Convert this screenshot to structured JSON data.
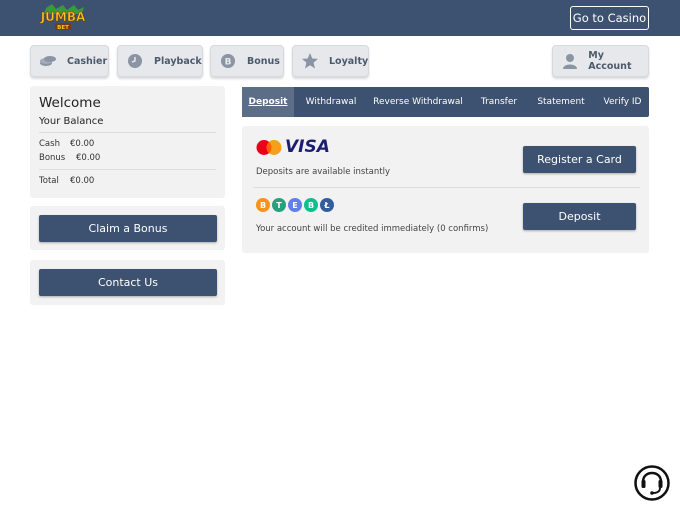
{
  "header": {
    "logo_text": "JUMBA",
    "logo_subtext": "BET",
    "go_casino_label": "Go to Casino"
  },
  "nav": {
    "cashier": "Cashier",
    "playback": "Playback",
    "bonus": "Bonus",
    "loyalty": "Loyalty",
    "my_account": "My Account"
  },
  "sidebar": {
    "welcome": "Welcome",
    "your_balance": "Your Balance",
    "cash_label": "Cash",
    "cash_value": "€0.00",
    "bonus_label": "Bonus",
    "bonus_value": "€0.00",
    "total_label": "Total",
    "total_value": "€0.00",
    "claim_bonus": "Claim a Bonus",
    "contact_us": "Contact Us"
  },
  "tabs": [
    "Deposit",
    "Withdrawal",
    "Reverse Withdrawal",
    "Transfer",
    "Statement",
    "Verify ID"
  ],
  "cards": {
    "visa_text": "VISA",
    "note": "Deposits are available instantly",
    "register_label": "Register a Card"
  },
  "crypto": {
    "coins": [
      "B",
      "T",
      "E",
      "B",
      "Ł"
    ],
    "note": "Your account will be credited immediately (0 confirms)",
    "deposit_label": "Deposit"
  },
  "colors": {
    "primary": "#3d5170",
    "active_tab": "#5c6e87",
    "panel": "#f2f2f2"
  }
}
